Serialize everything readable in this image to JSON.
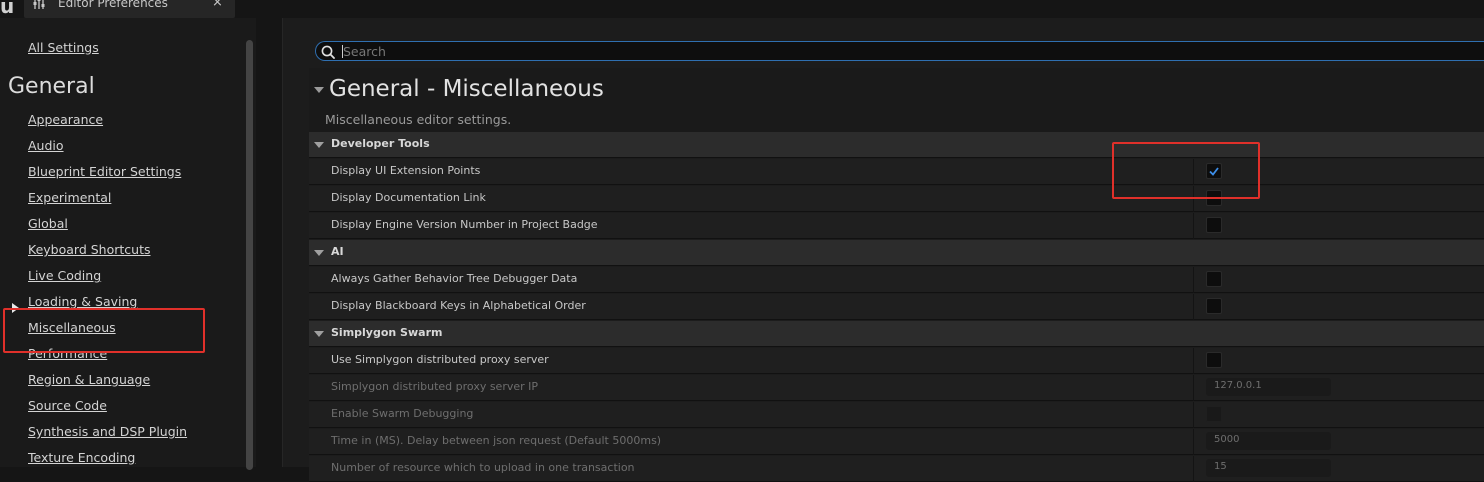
{
  "window": {
    "logo_text": "u",
    "tab_title": "Editor Preferences",
    "close_symbol": "×",
    "tab_icon": "sliders-icon"
  },
  "sidebar": {
    "all_settings": "All Settings",
    "heading": "General",
    "selected_item": "Miscellaneous",
    "items": [
      {
        "label": "Appearance"
      },
      {
        "label": "Audio"
      },
      {
        "label": "Blueprint Editor Settings"
      },
      {
        "label": "Experimental"
      },
      {
        "label": "Global"
      },
      {
        "label": "Keyboard Shortcuts"
      },
      {
        "label": "Live Coding"
      },
      {
        "label": "Loading & Saving"
      },
      {
        "label": "Miscellaneous"
      },
      {
        "label": "Performance"
      },
      {
        "label": "Region & Language"
      },
      {
        "label": "Source Code"
      },
      {
        "label": "Synthesis and DSP Plugin"
      },
      {
        "label": "Texture Encoding"
      }
    ]
  },
  "search": {
    "placeholder": "Search",
    "value": ""
  },
  "section": {
    "title": "General - Miscellaneous",
    "description": "Miscellaneous editor settings."
  },
  "categories": [
    {
      "label": "Developer Tools",
      "properties": [
        {
          "label": "Display UI Extension Points",
          "type": "checkbox",
          "checked": true,
          "enabled": true
        },
        {
          "label": "Display Documentation Link",
          "type": "checkbox",
          "checked": false,
          "enabled": true
        },
        {
          "label": "Display Engine Version Number in Project Badge",
          "type": "checkbox",
          "checked": false,
          "enabled": true
        }
      ]
    },
    {
      "label": "AI",
      "properties": [
        {
          "label": "Always Gather Behavior Tree Debugger Data",
          "type": "checkbox",
          "checked": false,
          "enabled": true
        },
        {
          "label": "Display Blackboard Keys in Alphabetical Order",
          "type": "checkbox",
          "checked": false,
          "enabled": true
        }
      ]
    },
    {
      "label": "Simplygon Swarm",
      "properties": [
        {
          "label": "Use Simplygon distributed proxy server",
          "type": "checkbox",
          "checked": false,
          "enabled": true
        },
        {
          "label": "Simplygon distributed proxy server IP",
          "type": "text",
          "value": "127.0.0.1",
          "enabled": false
        },
        {
          "label": "Enable Swarm Debugging",
          "type": "checkbox",
          "checked": false,
          "enabled": false
        },
        {
          "label": "Time in (MS). Delay between json request (Default 5000ms)",
          "type": "text",
          "value": "5000",
          "enabled": false
        },
        {
          "label": "Number of resource which to upload in one transaction",
          "type": "text",
          "value": "15",
          "enabled": false
        }
      ]
    }
  ],
  "colors": {
    "highlight": "#e0302a",
    "checkmark": "#3d8ee8",
    "search_border": "#2f6fb0"
  }
}
